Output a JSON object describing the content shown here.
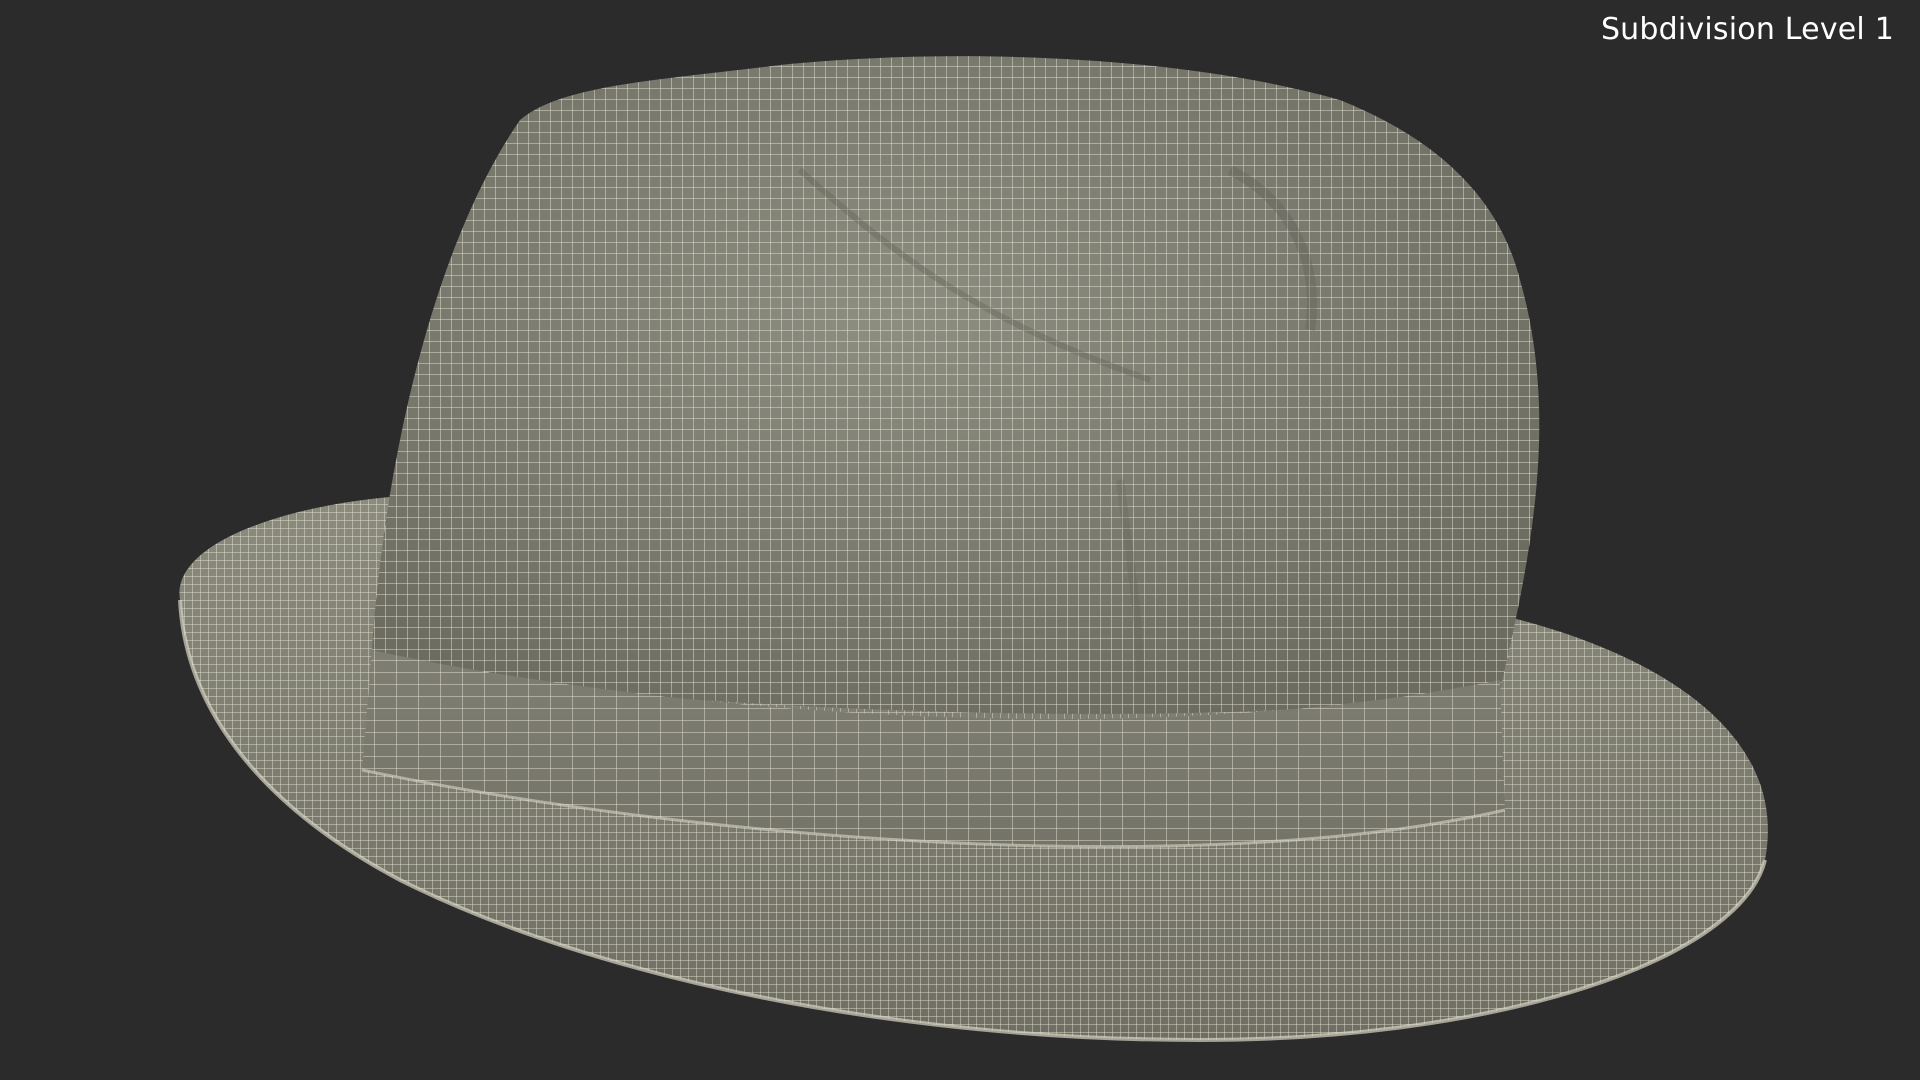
{
  "render": {
    "label": "Subdivision Level 1",
    "background_color": "#2b2b2b",
    "subject": "fedora-hat-wireframe-icon",
    "surface_color": "#8a8a7c",
    "wire_color": "#f2f0df"
  }
}
